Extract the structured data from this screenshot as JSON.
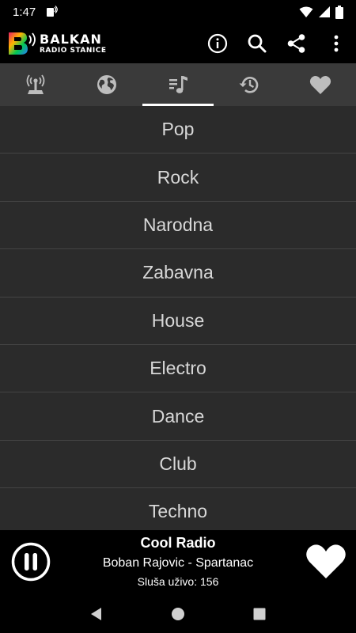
{
  "status_bar": {
    "time": "1:47",
    "icons": [
      "app-notification-icon",
      "wifi-icon",
      "signal-icon",
      "battery-icon"
    ]
  },
  "app_bar": {
    "logo_line1": "BALKAN",
    "logo_line2": "RADIO STANICE",
    "actions": [
      "info-icon",
      "search-icon",
      "share-icon",
      "more-vert-icon"
    ]
  },
  "tabs": [
    {
      "icon": "radio-tower-icon",
      "active": false
    },
    {
      "icon": "globe-icon",
      "active": false
    },
    {
      "icon": "music-genre-icon",
      "active": true
    },
    {
      "icon": "history-icon",
      "active": false
    },
    {
      "icon": "heart-icon",
      "active": false
    }
  ],
  "genres": [
    "Pop",
    "Rock",
    "Narodna",
    "Zabavna",
    "House",
    "Electro",
    "Dance",
    "Club",
    "Techno"
  ],
  "player": {
    "station": "Cool Radio",
    "track": "Boban Rajovic - Spartanac",
    "listeners": "Sluša uživo: 156",
    "state": "playing"
  },
  "nav": [
    "back-icon",
    "home-icon",
    "recents-icon"
  ],
  "colors": {
    "tab_bar": "#3a3a3a",
    "list_bg": "#2b2b2b",
    "divider": "#444444",
    "list_text": "#d8d8d8"
  }
}
